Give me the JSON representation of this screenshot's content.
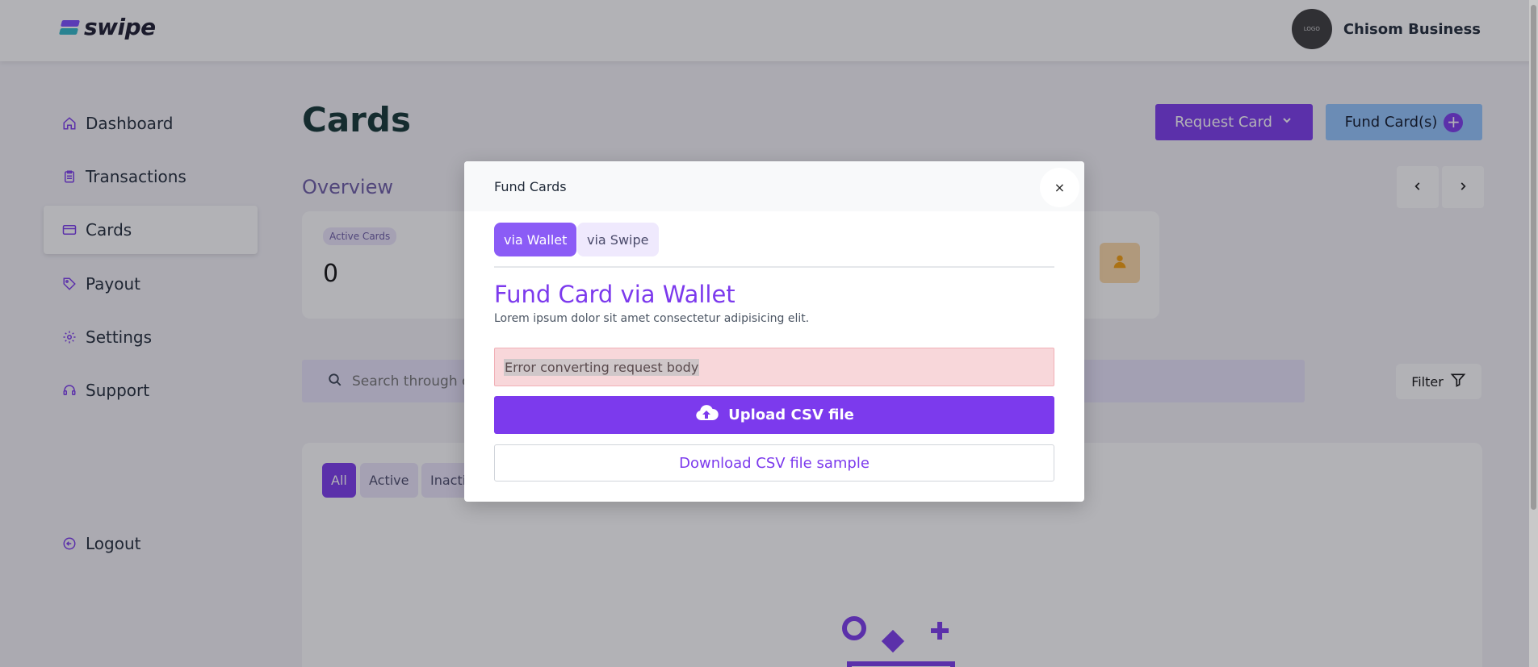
{
  "brand": {
    "name": "swipe",
    "logo_colors": [
      "#7c4dff",
      "#2fb8c8"
    ]
  },
  "header": {
    "avatar_text": "LOGO",
    "business_name": "Chisom Business"
  },
  "sidebar": {
    "items": [
      {
        "label": "Dashboard",
        "icon": "home-icon"
      },
      {
        "label": "Transactions",
        "icon": "clipboard-icon"
      },
      {
        "label": "Cards",
        "icon": "credit-card-icon",
        "active": true
      },
      {
        "label": "Payout",
        "icon": "tag-icon"
      },
      {
        "label": "Settings",
        "icon": "gear-icon"
      },
      {
        "label": "Support",
        "icon": "headset-icon"
      }
    ],
    "logout_label": "Logout"
  },
  "main": {
    "title": "Cards",
    "request_card_label": "Request Card",
    "fund_cards_label": "Fund Card(s)",
    "overview_title": "Overview",
    "stat": {
      "label": "Active Cards",
      "value": "0"
    },
    "search_placeholder": "Search through cards",
    "filter_label": "Filter",
    "chips": {
      "all": "All",
      "active": "Active",
      "inactive": "Inactive"
    }
  },
  "modal": {
    "title": "Fund Cards",
    "close_label": "×",
    "tabs": {
      "wallet": "via Wallet",
      "swipe": "via Swipe"
    },
    "heading": "Fund Card via Wallet",
    "subtitle": "Lorem ipsum dolor sit amet consectetur adipisicing elit.",
    "error": "Error converting request body",
    "upload_label": "Upload CSV file",
    "download_label": "Download CSV file sample"
  },
  "colors": {
    "primary": "#7c3aed",
    "accent_blue": "#93c5fd",
    "error_bg": "#f8d7da",
    "stat_icon_bg": "#fcd9a8"
  }
}
